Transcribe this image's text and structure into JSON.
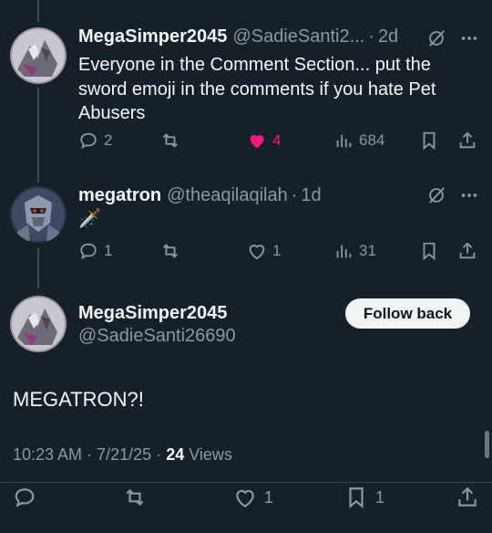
{
  "reply1": {
    "name": "MegaSimper2045",
    "handle": "@SadieSanti2...",
    "dot": "·",
    "age": "2d",
    "text": "Everyone in the Comment Section... put the sword emoji in the comments if you hate Pet Abusers",
    "replies": "2",
    "likes": "4",
    "views": "684"
  },
  "reply2": {
    "name": "megatron",
    "handle": "@theaqilaqilah",
    "dot": "·",
    "age": "1d",
    "text": "🗡️",
    "replies": "1",
    "likes": "1",
    "views": "31"
  },
  "main": {
    "name": "MegaSimper2045",
    "handle": "@SadieSanti26690",
    "follow_label": "Follow back",
    "text": "MEGATRON?!",
    "time": "10:23 AM",
    "sep": "·",
    "date": "7/21/25",
    "views_count": "24",
    "views_label": "Views",
    "likes": "1",
    "bookmarks": "1"
  },
  "colors": {
    "accent_like": "#f91880",
    "background": "#15202b",
    "muted": "#8b98a5"
  },
  "icons": [
    "grok-icon",
    "more-icon",
    "reply-icon",
    "retweet-icon",
    "heart-icon",
    "views-icon",
    "bookmark-icon",
    "share-icon"
  ]
}
